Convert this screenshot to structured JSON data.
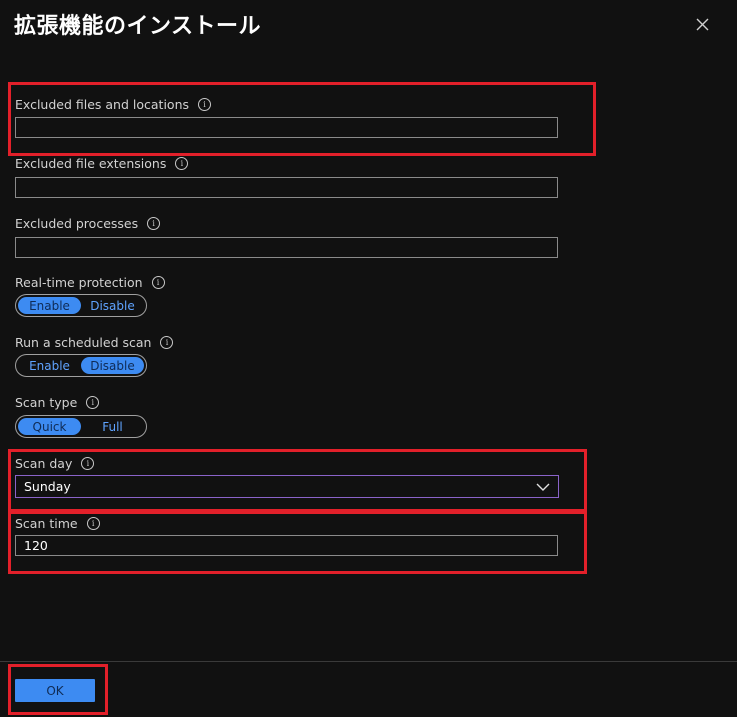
{
  "dialog": {
    "title": "拡張機能のインストール"
  },
  "fields": {
    "excluded_files": {
      "label": "Excluded files and locations",
      "value": ""
    },
    "excluded_ext": {
      "label": "Excluded file extensions",
      "value": ""
    },
    "excluded_proc": {
      "label": "Excluded processes",
      "value": ""
    },
    "realtime": {
      "label": "Real-time protection",
      "options": [
        "Enable",
        "Disable"
      ],
      "selected": "Enable"
    },
    "scheduled": {
      "label": "Run a scheduled scan",
      "options": [
        "Enable",
        "Disable"
      ],
      "selected": "Disable"
    },
    "scan_type": {
      "label": "Scan type",
      "options": [
        "Quick",
        "Full"
      ],
      "selected": "Quick"
    },
    "scan_day": {
      "label": "Scan day",
      "value": "Sunday"
    },
    "scan_time": {
      "label": "Scan time",
      "value": "120"
    }
  },
  "footer": {
    "ok_label": "OK"
  },
  "icons": {
    "info": "info-icon",
    "close": "close-icon",
    "chevron": "chevron-down-icon"
  },
  "colors": {
    "accent": "#3d8bf2",
    "highlight": "#e3202a",
    "background": "#111111"
  }
}
